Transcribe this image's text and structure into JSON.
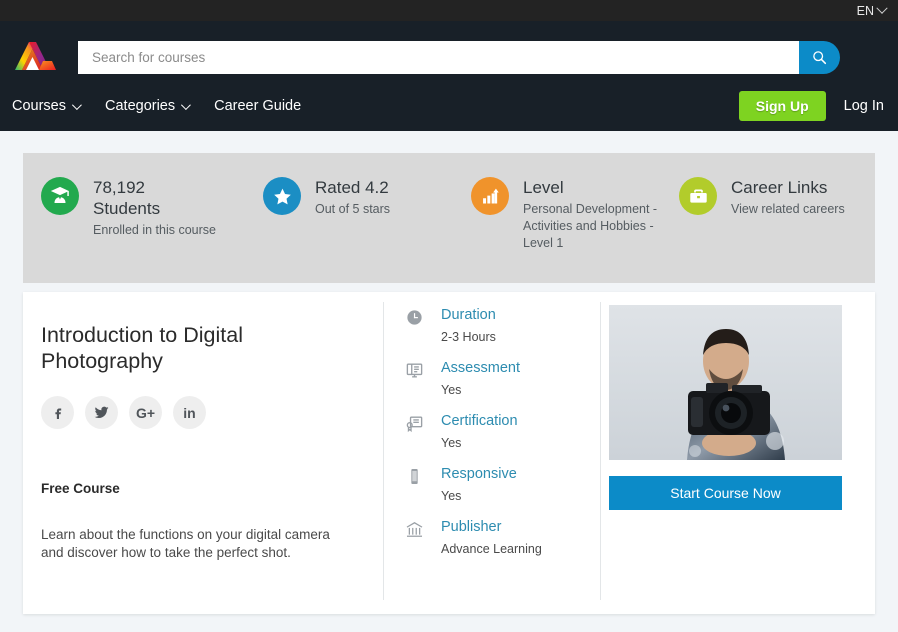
{
  "topbar": {
    "language": "EN"
  },
  "header": {
    "search": {
      "placeholder": "Search for courses",
      "value": "",
      "icon": "search-icon"
    },
    "nav": [
      {
        "label": "Courses",
        "has_caret": true
      },
      {
        "label": "Categories",
        "has_caret": true
      },
      {
        "label": "Career Guide",
        "has_caret": false
      }
    ],
    "sign_up_label": "Sign Up",
    "log_in_label": "Log In",
    "logo_name": "site-logo"
  },
  "stats": [
    {
      "icon": "graduate-cap-icon",
      "color": "#22a94e",
      "title_line1": "78,192",
      "title_line2": "Students",
      "sub": "Enrolled in this course"
    },
    {
      "icon": "star-icon",
      "color": "#1b8ec4",
      "title_line1": "Rated 4.2",
      "title_line2": "",
      "sub": "Out of 5 stars"
    },
    {
      "icon": "bar-chart-icon",
      "color": "#f0932b",
      "title_line1": "Level",
      "title_line2": "",
      "sub": "Personal Development - Activities and Hobbies - Level 1"
    },
    {
      "icon": "briefcase-icon",
      "color": "#b2cc2b",
      "title_line1": "Career Links",
      "title_line2": "",
      "sub": "View related careers"
    }
  ],
  "course": {
    "title": "Introduction to Digital Photography",
    "socials": [
      {
        "name": "facebook-icon",
        "label": "f"
      },
      {
        "name": "twitter-icon",
        "label": "t"
      },
      {
        "name": "google-plus-icon",
        "label": "G+"
      },
      {
        "name": "linkedin-icon",
        "label": "in"
      }
    ],
    "price_label": "Free Course",
    "description": "Learn about the functions on your digital camera and discover how to take the perfect shot.",
    "details": [
      {
        "icon": "clock-icon",
        "label": "Duration",
        "value": "2-3 Hours"
      },
      {
        "icon": "assessment-icon",
        "label": "Assessment",
        "value": "Yes"
      },
      {
        "icon": "certificate-icon",
        "label": "Certification",
        "value": "Yes"
      },
      {
        "icon": "mobile-icon",
        "label": "Responsive",
        "value": "Yes"
      },
      {
        "icon": "bank-icon",
        "label": "Publisher",
        "value": "Advance Learning"
      }
    ],
    "image_alt": "man holding a camera in outstretched hand",
    "start_button_label": "Start Course Now"
  },
  "colors": {
    "header_bg": "#182028",
    "topbar_bg": "#232323",
    "accent_blue": "#0c8bc8",
    "accent_green": "#7ed321",
    "link_teal": "#2d8cb0",
    "stats_bg": "#d9d9d9",
    "page_bg": "#f2f5f8"
  }
}
